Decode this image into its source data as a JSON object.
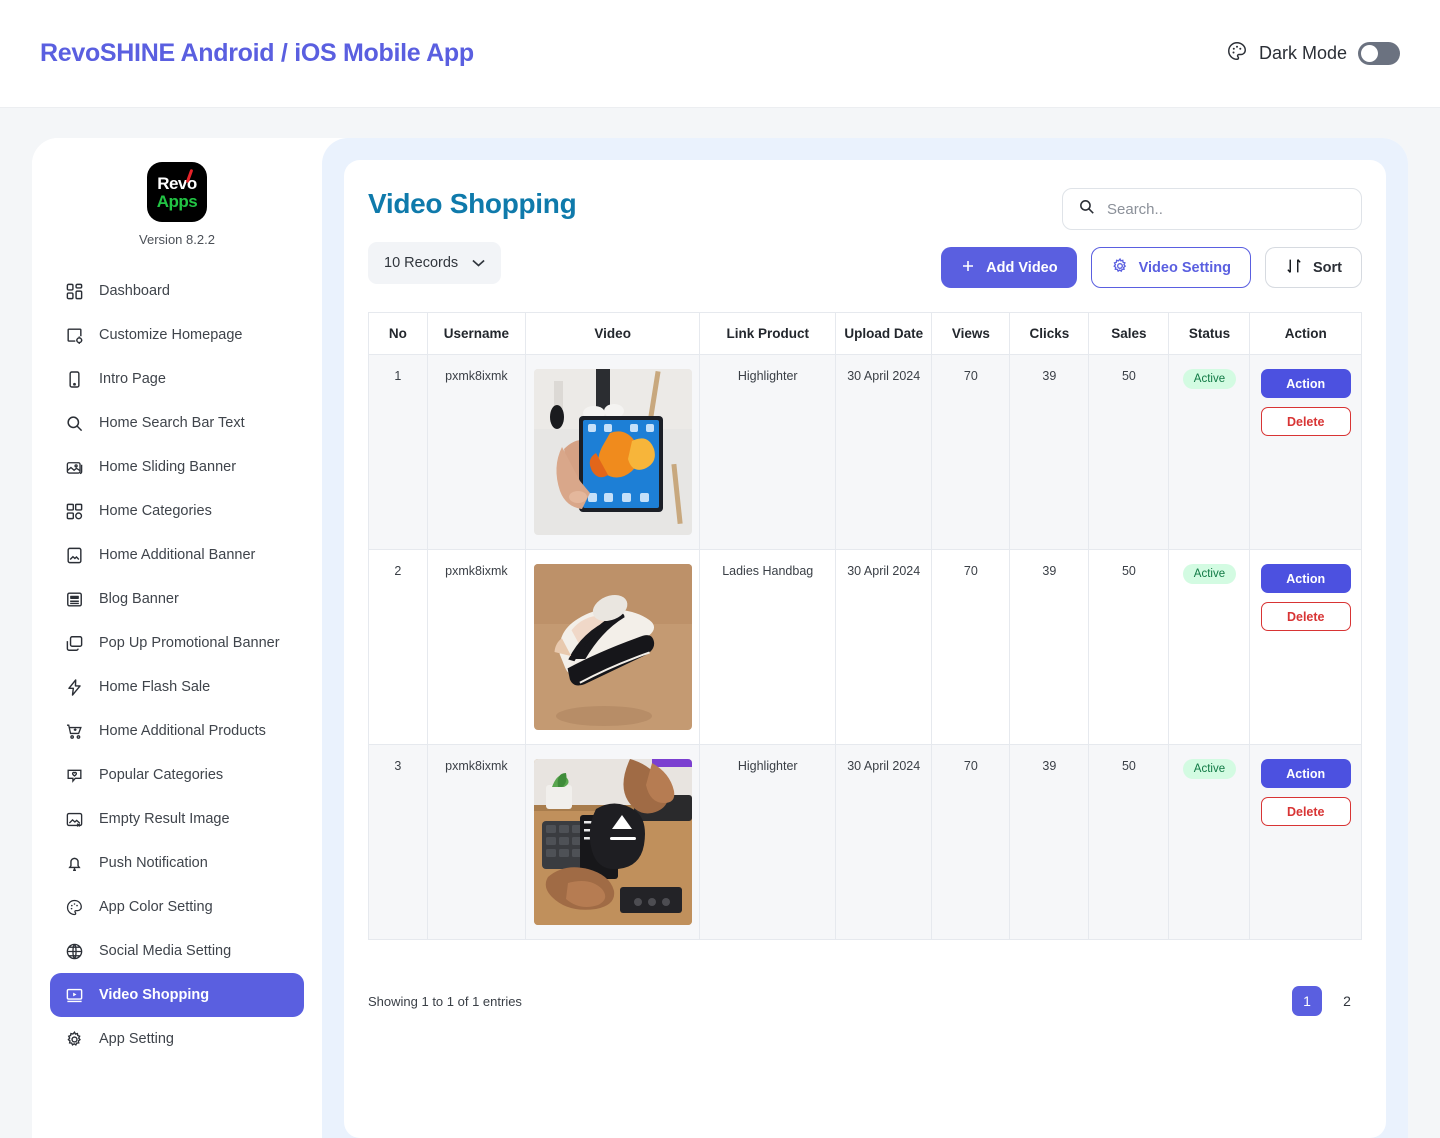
{
  "header": {
    "app_title": "RevoSHINE Android / iOS Mobile App",
    "dark_mode_label": "Dark Mode",
    "dark_mode_on": false,
    "title_color": "#5a5fe0"
  },
  "sidebar": {
    "logo_line1": "Revo",
    "logo_line2": "Apps",
    "version": "Version 8.2.2",
    "items": [
      {
        "label": "Dashboard",
        "icon": "dashboard-icon",
        "active": false
      },
      {
        "label": "Customize Homepage",
        "icon": "customize-homepage-icon",
        "active": false
      },
      {
        "label": "Intro Page",
        "icon": "mobile-icon",
        "active": false
      },
      {
        "label": "Home Search Bar Text",
        "icon": "search-icon",
        "active": false
      },
      {
        "label": "Home Sliding Banner",
        "icon": "images-icon",
        "active": false
      },
      {
        "label": "Home Categories",
        "icon": "grid-icon",
        "active": false
      },
      {
        "label": "Home Additional Banner",
        "icon": "image-icon",
        "active": false
      },
      {
        "label": "Blog Banner",
        "icon": "article-icon",
        "active": false
      },
      {
        "label": "Pop Up Promotional Banner",
        "icon": "windows-icon",
        "active": false
      },
      {
        "label": "Home Flash Sale",
        "icon": "bolt-icon",
        "active": false
      },
      {
        "label": "Home Additional Products",
        "icon": "cart-plus-icon",
        "active": false
      },
      {
        "label": "Popular Categories",
        "icon": "heart-chat-icon",
        "active": false
      },
      {
        "label": "Empty Result Image",
        "icon": "image-x-icon",
        "active": false
      },
      {
        "label": "Push Notification",
        "icon": "bell-icon",
        "active": false
      },
      {
        "label": "App Color Setting",
        "icon": "palette-icon",
        "active": false
      },
      {
        "label": "Social Media Setting",
        "icon": "globe-icon",
        "active": false
      },
      {
        "label": "Video Shopping",
        "icon": "video-icon",
        "active": true
      },
      {
        "label": "App Setting",
        "icon": "gear-icon",
        "active": false
      }
    ],
    "active_bg": "#5a5fe0"
  },
  "main": {
    "page_title": "Video Shopping",
    "page_title_color": "#0f7aab",
    "records_select": "10 Records",
    "search_placeholder": "Search..",
    "search_value": "",
    "buttons": {
      "add_video": "Add Video",
      "video_setting": "Video Setting",
      "sort": "Sort"
    },
    "table": {
      "columns": [
        "No",
        "Username",
        "Video",
        "Link Product",
        "Upload Date",
        "Views",
        "Clicks",
        "Sales",
        "Status",
        "Action"
      ],
      "rows": [
        {
          "no": "1",
          "username": "pxmk8ixmk",
          "thumb": "hand-holding-foldable-phone",
          "link_product": "Highlighter",
          "upload_date": "30 April 2024",
          "views": "70",
          "clicks": "39",
          "sales": "50",
          "status": "Active",
          "action": "Action",
          "delete": "Delete"
        },
        {
          "no": "2",
          "username": "pxmk8ixmk",
          "thumb": "white-sneaker-on-tan",
          "link_product": "Ladies Handbag",
          "upload_date": "30 April 2024",
          "views": "70",
          "clicks": "39",
          "sales": "50",
          "status": "Active",
          "action": "Action",
          "delete": "Delete"
        },
        {
          "no": "3",
          "username": "pxmk8ixmk",
          "thumb": "hands-opening-pouch-at-desk",
          "link_product": "Highlighter",
          "upload_date": "30 April 2024",
          "views": "70",
          "clicks": "39",
          "sales": "50",
          "status": "Active",
          "action": "Action",
          "delete": "Delete"
        }
      ]
    },
    "footer": {
      "showing": "Showing 1 to 1 of 1 entries",
      "pages": [
        "1",
        "2"
      ],
      "active_page": "1"
    }
  }
}
